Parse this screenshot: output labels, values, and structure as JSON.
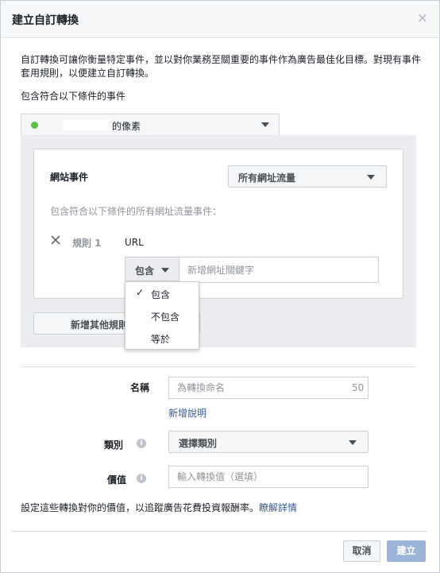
{
  "dialog": {
    "title": "建立自訂轉換",
    "close_glyph": "×"
  },
  "description": "自訂轉換可讓你衡量特定事件，並以對你業務至關重要的事件作為廣告最佳化目標。對現有事件套用規則，以便建立自訂轉換。",
  "include_label": "包含符合以下條件的事件",
  "pixel_selector": {
    "label": "的像素",
    "status_color": "#5ac33f"
  },
  "rule_card": {
    "event_label": "網站事件",
    "event_select": "所有網址流量",
    "hint": "包含符合以下條件的所有網址流量事件：",
    "rule_label": "規則 1",
    "field_label": "URL",
    "operator_select": "包含",
    "keyword_placeholder": "新增網址關鍵字",
    "add_rule_button": "新增其他規則"
  },
  "operator_dropdown": {
    "options": [
      {
        "label": "包含",
        "selected": true
      },
      {
        "label": "不包含",
        "selected": false
      },
      {
        "label": "等於",
        "selected": false
      }
    ],
    "check_glyph": "✓"
  },
  "form": {
    "name_label": "名稱",
    "name_placeholder": "為轉換命名",
    "name_counter": "50",
    "add_description_link": "新增說明",
    "category_label": "類別",
    "category_select": "選擇類別",
    "value_label": "價值",
    "value_placeholder": "輸入轉換值（選填）"
  },
  "footer": {
    "note": "設定這些轉換對你的價值，以追蹤廣告花費投資報酬率。",
    "learn_more": "瞭解詳情",
    "cancel_button": "取消",
    "create_button": "建立"
  },
  "colors": {
    "link": "#365899",
    "primary_disabled": "#9cb4d8",
    "panel_bg": "#ebedf0"
  }
}
